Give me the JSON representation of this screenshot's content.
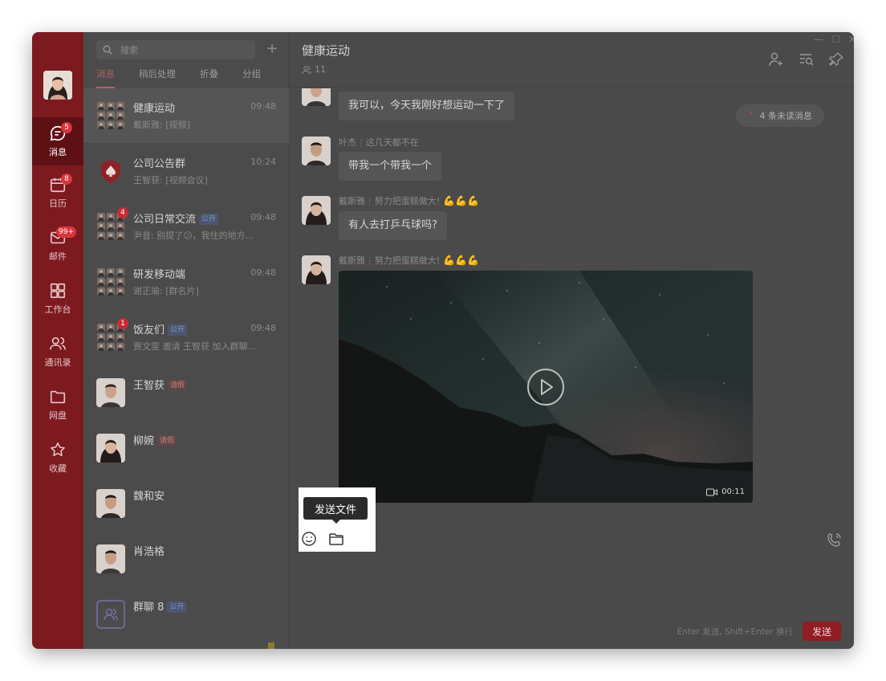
{
  "rail": {
    "items": [
      {
        "label": "消息",
        "badge": "5"
      },
      {
        "label": "日历",
        "badge": "8"
      },
      {
        "label": "邮件",
        "badge": "99+"
      },
      {
        "label": "工作台",
        "badge": ""
      },
      {
        "label": "通讯录",
        "badge": ""
      },
      {
        "label": "网盘",
        "badge": ""
      },
      {
        "label": "收藏",
        "badge": ""
      }
    ]
  },
  "list": {
    "search_placeholder": "搜索",
    "plus": "+",
    "tabs": [
      "消息",
      "稍后处理",
      "折叠",
      "分组"
    ],
    "conversations": [
      {
        "name": "健康运动",
        "time": "09:48",
        "preview": "戴斯雅: [视频]",
        "tag": "",
        "badge": ""
      },
      {
        "name": "公司公告群",
        "time": "10:24",
        "preview": "王智获: [视频会议]",
        "tag": "",
        "badge": ""
      },
      {
        "name": "公司日常交流",
        "time": "09:48",
        "preview": "尹音: 别提了😕，我住的地方…",
        "tag": "公开",
        "badge": "4"
      },
      {
        "name": "研发移动端",
        "time": "09:48",
        "preview": "谢正瑜: [群名片]",
        "tag": "",
        "badge": ""
      },
      {
        "name": "饭友们",
        "time": "09:48",
        "preview": "贾文雯 邀请 王智获 加入群聊…",
        "tag": "公开",
        "badge": "1"
      },
      {
        "name": "王智获",
        "time": "",
        "preview": "",
        "tag": "请假",
        "badge": ""
      },
      {
        "name": "柳婉",
        "time": "",
        "preview": "",
        "tag": "请假",
        "badge": ""
      },
      {
        "name": "魏和安",
        "time": "",
        "preview": "",
        "tag": "",
        "badge": ""
      },
      {
        "name": "肖浩格",
        "time": "",
        "preview": "",
        "tag": "",
        "badge": ""
      },
      {
        "name": "群聊 8",
        "time": "",
        "preview": "",
        "tag": "公开",
        "badge": ""
      }
    ]
  },
  "chat": {
    "title": "健康运动",
    "members": "11",
    "unread": "4 条未读消息",
    "messages": [
      {
        "sender": "",
        "status": "",
        "text": "我可以，今天我刚好想运动一下了"
      },
      {
        "sender": "叶杰",
        "status": "这几天都不在",
        "text": "带我一个带我一个"
      },
      {
        "sender": "戴斯雅",
        "status": "努力把蛋糕做大!",
        "text": "有人去打乒乓球吗?"
      },
      {
        "sender": "戴斯雅",
        "status": "努力把蛋糕做大!",
        "text": ""
      }
    ],
    "video_duration": "00:11",
    "tooltip": "发送文件",
    "hint": "Enter 发送, Shift+Enter 换行",
    "send": "发送"
  },
  "colors": {
    "rail": "#7c1a1f",
    "accent": "#8f1d22",
    "badge": "#d9353d"
  },
  "icons": [
    "search-icon",
    "plus-icon",
    "message-icon",
    "calendar-icon",
    "mail-icon",
    "workbench-icon",
    "contacts-icon",
    "folder-icon",
    "star-icon",
    "add-member-icon",
    "search-history-icon",
    "pin-icon",
    "more-icon",
    "emoji-icon",
    "file-icon",
    "voice-icon",
    "play-icon",
    "video-icon"
  ]
}
